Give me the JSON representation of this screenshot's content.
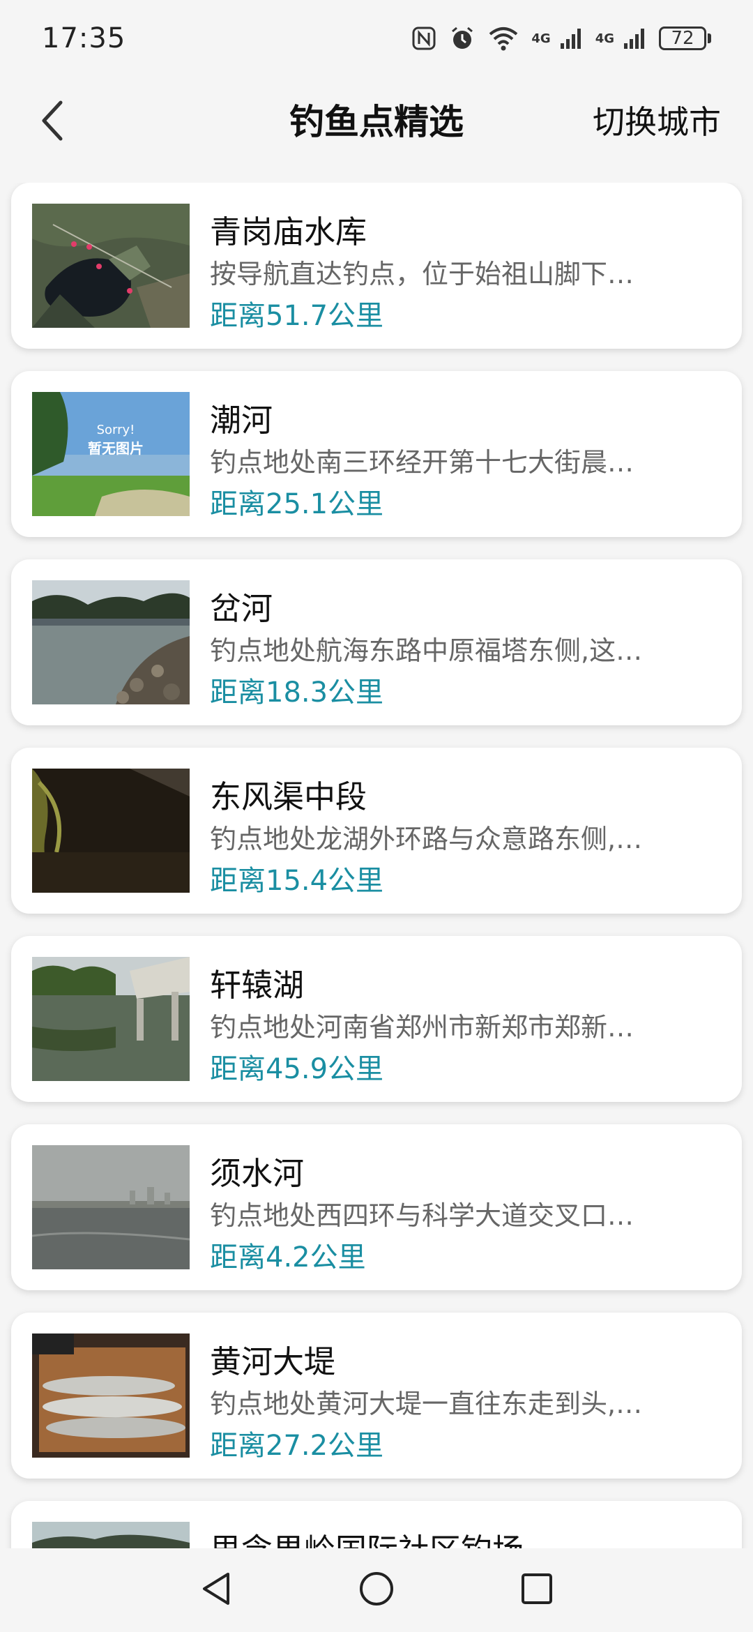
{
  "status_bar": {
    "time": "17:35",
    "network_1": "4G",
    "network_2": "4G",
    "battery": "72"
  },
  "header": {
    "title": "钓鱼点精选",
    "action": "切换城市"
  },
  "spots": [
    {
      "name": "青岗庙水库",
      "desc": "按导航直达钓点，位于始祖山脚下…",
      "distance": "距离51.7公里"
    },
    {
      "name": "潮河",
      "desc": "钓点地处南三环经开第十七大街晨…",
      "distance": "距离25.1公里",
      "thumb_text_1": "Sorry!",
      "thumb_text_2": "暂无图片"
    },
    {
      "name": "岔河",
      "desc": "钓点地处航海东路中原福塔东侧,这…",
      "distance": "距离18.3公里"
    },
    {
      "name": "东风渠中段",
      "desc": "钓点地处龙湖外环路与众意路东侧,…",
      "distance": "距离15.4公里"
    },
    {
      "name": "轩辕湖",
      "desc": "钓点地处河南省郑州市新郑市郑新…",
      "distance": "距离45.9公里"
    },
    {
      "name": "须水河",
      "desc": "钓点地处西四环与科学大道交叉口…",
      "distance": "距离4.2公里"
    },
    {
      "name": "黄河大堤",
      "desc": "钓点地处黄河大堤一直往东走到头,…",
      "distance": "距离27.2公里"
    },
    {
      "name": "思念果岭国际社区钓场",
      "desc": "",
      "distance": ""
    }
  ],
  "icons": {
    "back": "chevron-left-icon",
    "nfc": "nfc-icon",
    "alarm": "alarm-icon",
    "wifi": "wifi-icon",
    "nav_back": "triangle-back-icon",
    "nav_home": "circle-home-icon",
    "nav_recents": "square-recents-icon"
  },
  "colors": {
    "distance": "#1a8ea2",
    "background": "#f5f5f5"
  }
}
